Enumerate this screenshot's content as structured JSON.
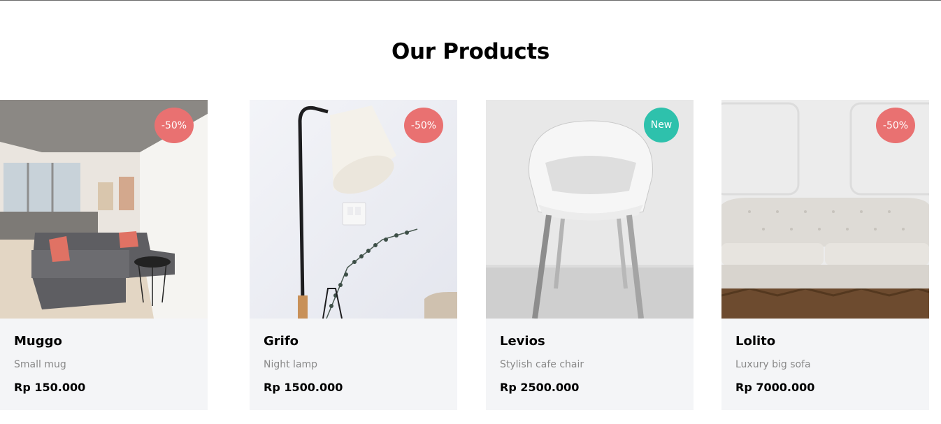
{
  "section": {
    "title": "Our Products"
  },
  "products": [
    {
      "name": "Grifo",
      "description": "Night lamp",
      "price": "Rp 1500.000",
      "badge": "-50%",
      "badge_color": "#e97171",
      "image": "floor-lamp-image"
    },
    {
      "name": "Levios",
      "description": "Stylish cafe chair",
      "price": "Rp 2500.000",
      "badge": "New",
      "badge_color": "#2ec1ac",
      "image": "white-chair-image"
    },
    {
      "name": "Lolito",
      "description": "Luxury big sofa",
      "price": "Rp 7000.000",
      "badge": "-50%",
      "badge_color": "#e97171",
      "image": "white-sofa-image"
    },
    {
      "name": "Muggo",
      "description": "Small mug",
      "price": "Rp 150.000",
      "badge": "-50%",
      "badge_color": "#e97171",
      "image": "living-room-image"
    }
  ],
  "colors": {
    "card_background": "#f4f5f7",
    "muted_text": "#898989"
  }
}
